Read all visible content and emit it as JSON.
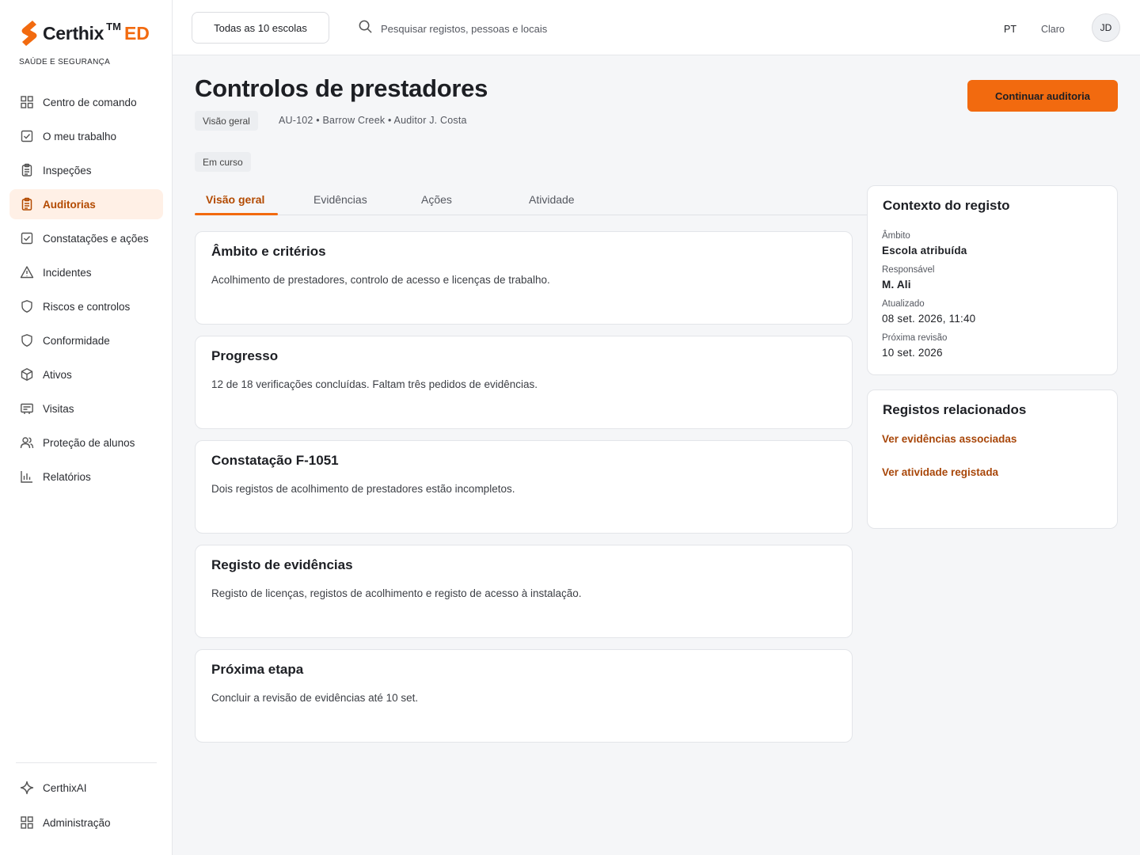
{
  "brand": {
    "name": "Certhix",
    "tm": "TM",
    "suffix": "ED",
    "tagline": "SAÚDE E SEGURANÇA",
    "accent_color": "#f26a0f"
  },
  "sidebar": {
    "items": [
      {
        "label": "Centro de comando",
        "icon": "grid-icon",
        "active": false
      },
      {
        "label": "O meu trabalho",
        "icon": "checkbox-icon",
        "active": false
      },
      {
        "label": "Inspeções",
        "icon": "clipboard-icon",
        "active": false
      },
      {
        "label": "Auditorias",
        "icon": "clipboard-list-icon",
        "active": true
      },
      {
        "label": "Constatações e ações",
        "icon": "checkbox-icon",
        "active": false
      },
      {
        "label": "Incidentes",
        "icon": "warning-icon",
        "active": false
      },
      {
        "label": "Riscos e controlos",
        "icon": "shield-icon",
        "active": false
      },
      {
        "label": "Conformidade",
        "icon": "shield-icon",
        "active": false
      },
      {
        "label": "Ativos",
        "icon": "cube-icon",
        "active": false
      },
      {
        "label": "Visitas",
        "icon": "id-card-icon",
        "active": false
      },
      {
        "label": "Proteção de alunos",
        "icon": "users-icon",
        "active": false
      },
      {
        "label": "Relatórios",
        "icon": "bar-chart-icon",
        "active": false
      }
    ],
    "bottom": [
      {
        "label": "CerthixAI",
        "icon": "sparkle-icon"
      },
      {
        "label": "Administração",
        "icon": "grid-icon"
      }
    ]
  },
  "topbar": {
    "school_selector": "Todas as 10 escolas",
    "search_placeholder": "Pesquisar registos, pessoas e locais",
    "language": "PT",
    "theme": "Claro",
    "avatar_initials": "JD"
  },
  "header": {
    "title": "Controlos de prestadores",
    "crumb": "Visão geral",
    "meta": "AU-102 • Barrow Creek • Auditor J. Costa",
    "status": "Em curso",
    "primary_action": "Continuar auditoria"
  },
  "tabs": [
    {
      "label": "Visão geral",
      "active": true
    },
    {
      "label": "Evidências",
      "active": false
    },
    {
      "label": "Ações",
      "active": false
    },
    {
      "label": "Atividade",
      "active": false
    }
  ],
  "cards": [
    {
      "title": "Âmbito e critérios",
      "body": "Acolhimento de prestadores, controlo de acesso e licenças de trabalho."
    },
    {
      "title": "Progresso",
      "body": "12 de 18 verificações concluídas. Faltam três pedidos de evidências."
    },
    {
      "title": "Constatação F-1051",
      "body": "Dois registos de acolhimento de prestadores estão incompletos."
    },
    {
      "title": "Registo de evidências",
      "body": "Registo de licenças, registos de acolhimento e registo de acesso à instalação."
    },
    {
      "title": "Próxima etapa",
      "body": "Concluir a revisão de evidências até 10 set."
    }
  ],
  "context": {
    "title": "Contexto do registo",
    "fields": [
      {
        "label": "Âmbito",
        "value": "Escola atribuída"
      },
      {
        "label": "Responsável",
        "value": "M. Ali"
      },
      {
        "label": "Atualizado",
        "value": "08 set. 2026, 11:40"
      },
      {
        "label": "Próxima revisão",
        "value": "10 set. 2026"
      }
    ]
  },
  "related": {
    "title": "Registos relacionados",
    "links": [
      "Ver evidências associadas",
      "Ver atividade registada"
    ]
  }
}
